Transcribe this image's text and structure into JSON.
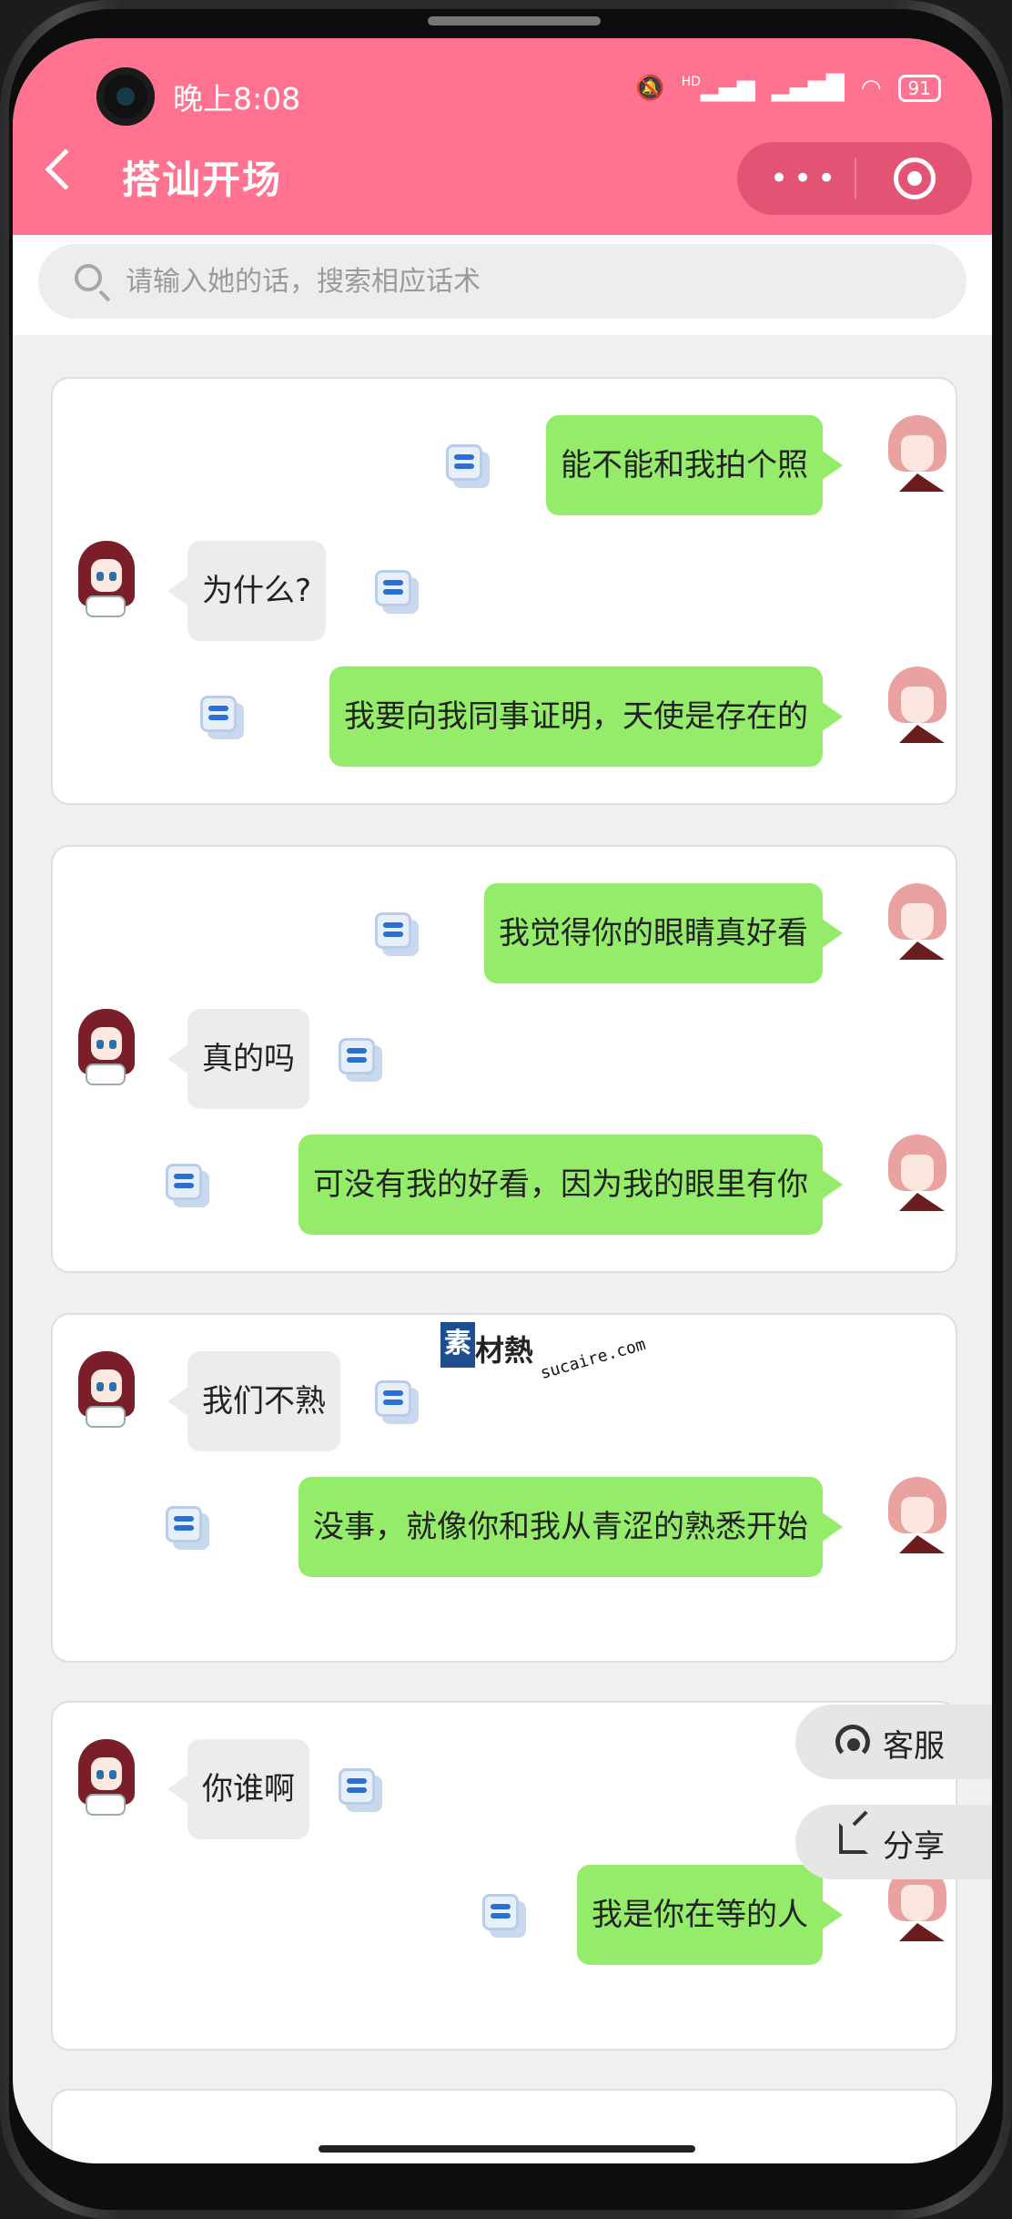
{
  "status_bar": {
    "time": "晚上8:08",
    "signal_label": "HD",
    "battery": "91"
  },
  "header": {
    "title": "搭讪开场",
    "more_label": "•••",
    "icons": [
      "back-icon",
      "more-icon",
      "target-icon"
    ]
  },
  "search": {
    "placeholder": "请输入她的话，搜索相应话术"
  },
  "conversations": [
    {
      "messages": [
        {
          "from": "me",
          "text": "能不能和我拍个照"
        },
        {
          "from": "her",
          "text": "为什么?"
        },
        {
          "from": "me",
          "text": "我要向我同事证明，天使是存在的"
        }
      ]
    },
    {
      "messages": [
        {
          "from": "me",
          "text": "我觉得你的眼睛真好看"
        },
        {
          "from": "her",
          "text": "真的吗"
        },
        {
          "from": "me",
          "text": "可没有我的好看，因为我的眼里有你"
        }
      ]
    },
    {
      "messages": [
        {
          "from": "her",
          "text": "我们不熟"
        },
        {
          "from": "me",
          "text": "没事，就像你和我从青涩的熟悉开始"
        }
      ]
    },
    {
      "messages": [
        {
          "from": "her",
          "text": "你谁啊"
        },
        {
          "from": "me",
          "text": "我是你在等的人"
        }
      ]
    }
  ],
  "floating": {
    "service_label": "客服",
    "share_label": "分享"
  },
  "watermark": {
    "box": "素",
    "text": "材熱",
    "url": "sucaire.com"
  }
}
